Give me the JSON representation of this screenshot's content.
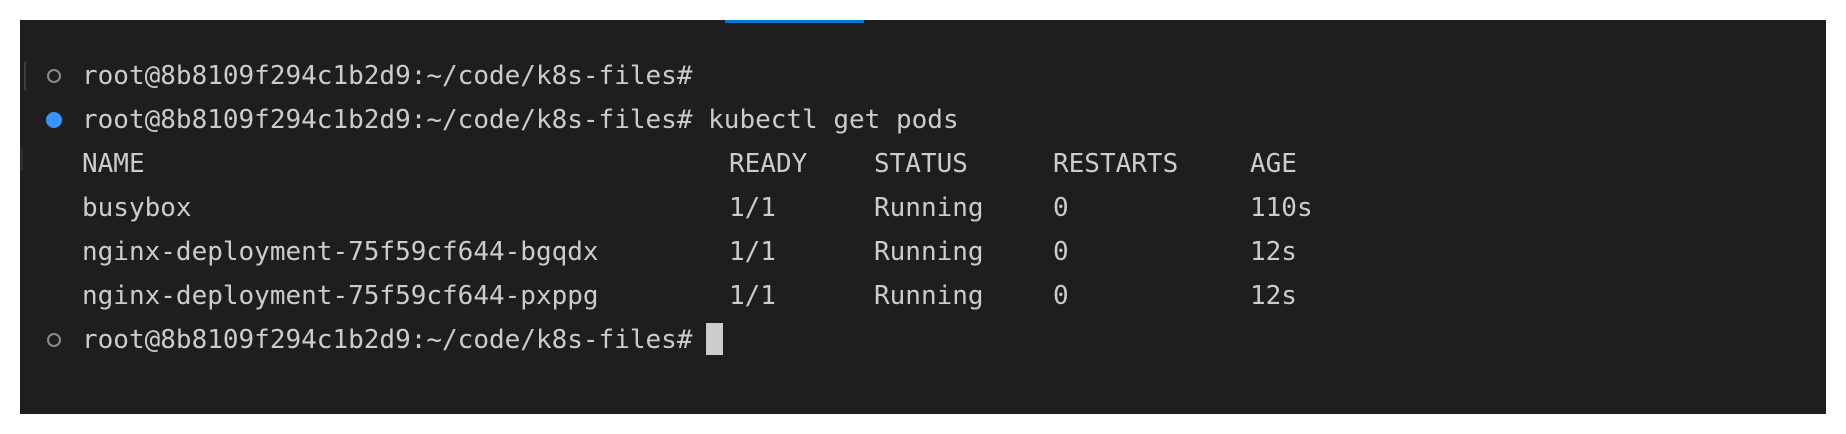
{
  "terminal": {
    "prompt": "root@8b8109f294c1b2d9:~/code/k8s-files#",
    "command": "kubectl get pods",
    "headers": {
      "name": "NAME",
      "ready": "READY",
      "status": "STATUS",
      "restarts": "RESTARTS",
      "age": "AGE"
    },
    "pods": [
      {
        "name": "busybox",
        "ready": "1/1",
        "status": "Running",
        "restarts": "0",
        "age": "110s"
      },
      {
        "name": "nginx-deployment-75f59cf644-bgqdx",
        "ready": "1/1",
        "status": "Running",
        "restarts": "0",
        "age": "12s"
      },
      {
        "name": "nginx-deployment-75f59cf644-pxppg",
        "ready": "1/1",
        "status": "Running",
        "restarts": "0",
        "age": "12s"
      }
    ]
  },
  "colors": {
    "background": "#1e1e1e",
    "foreground": "#cccccc",
    "accent": "#0078d4",
    "success_decoration": "#3794ff",
    "default_decoration": "#8a8a8a"
  },
  "icons": {
    "prompt_default": "circle-outline-icon",
    "prompt_success": "filled-circle-icon"
  }
}
